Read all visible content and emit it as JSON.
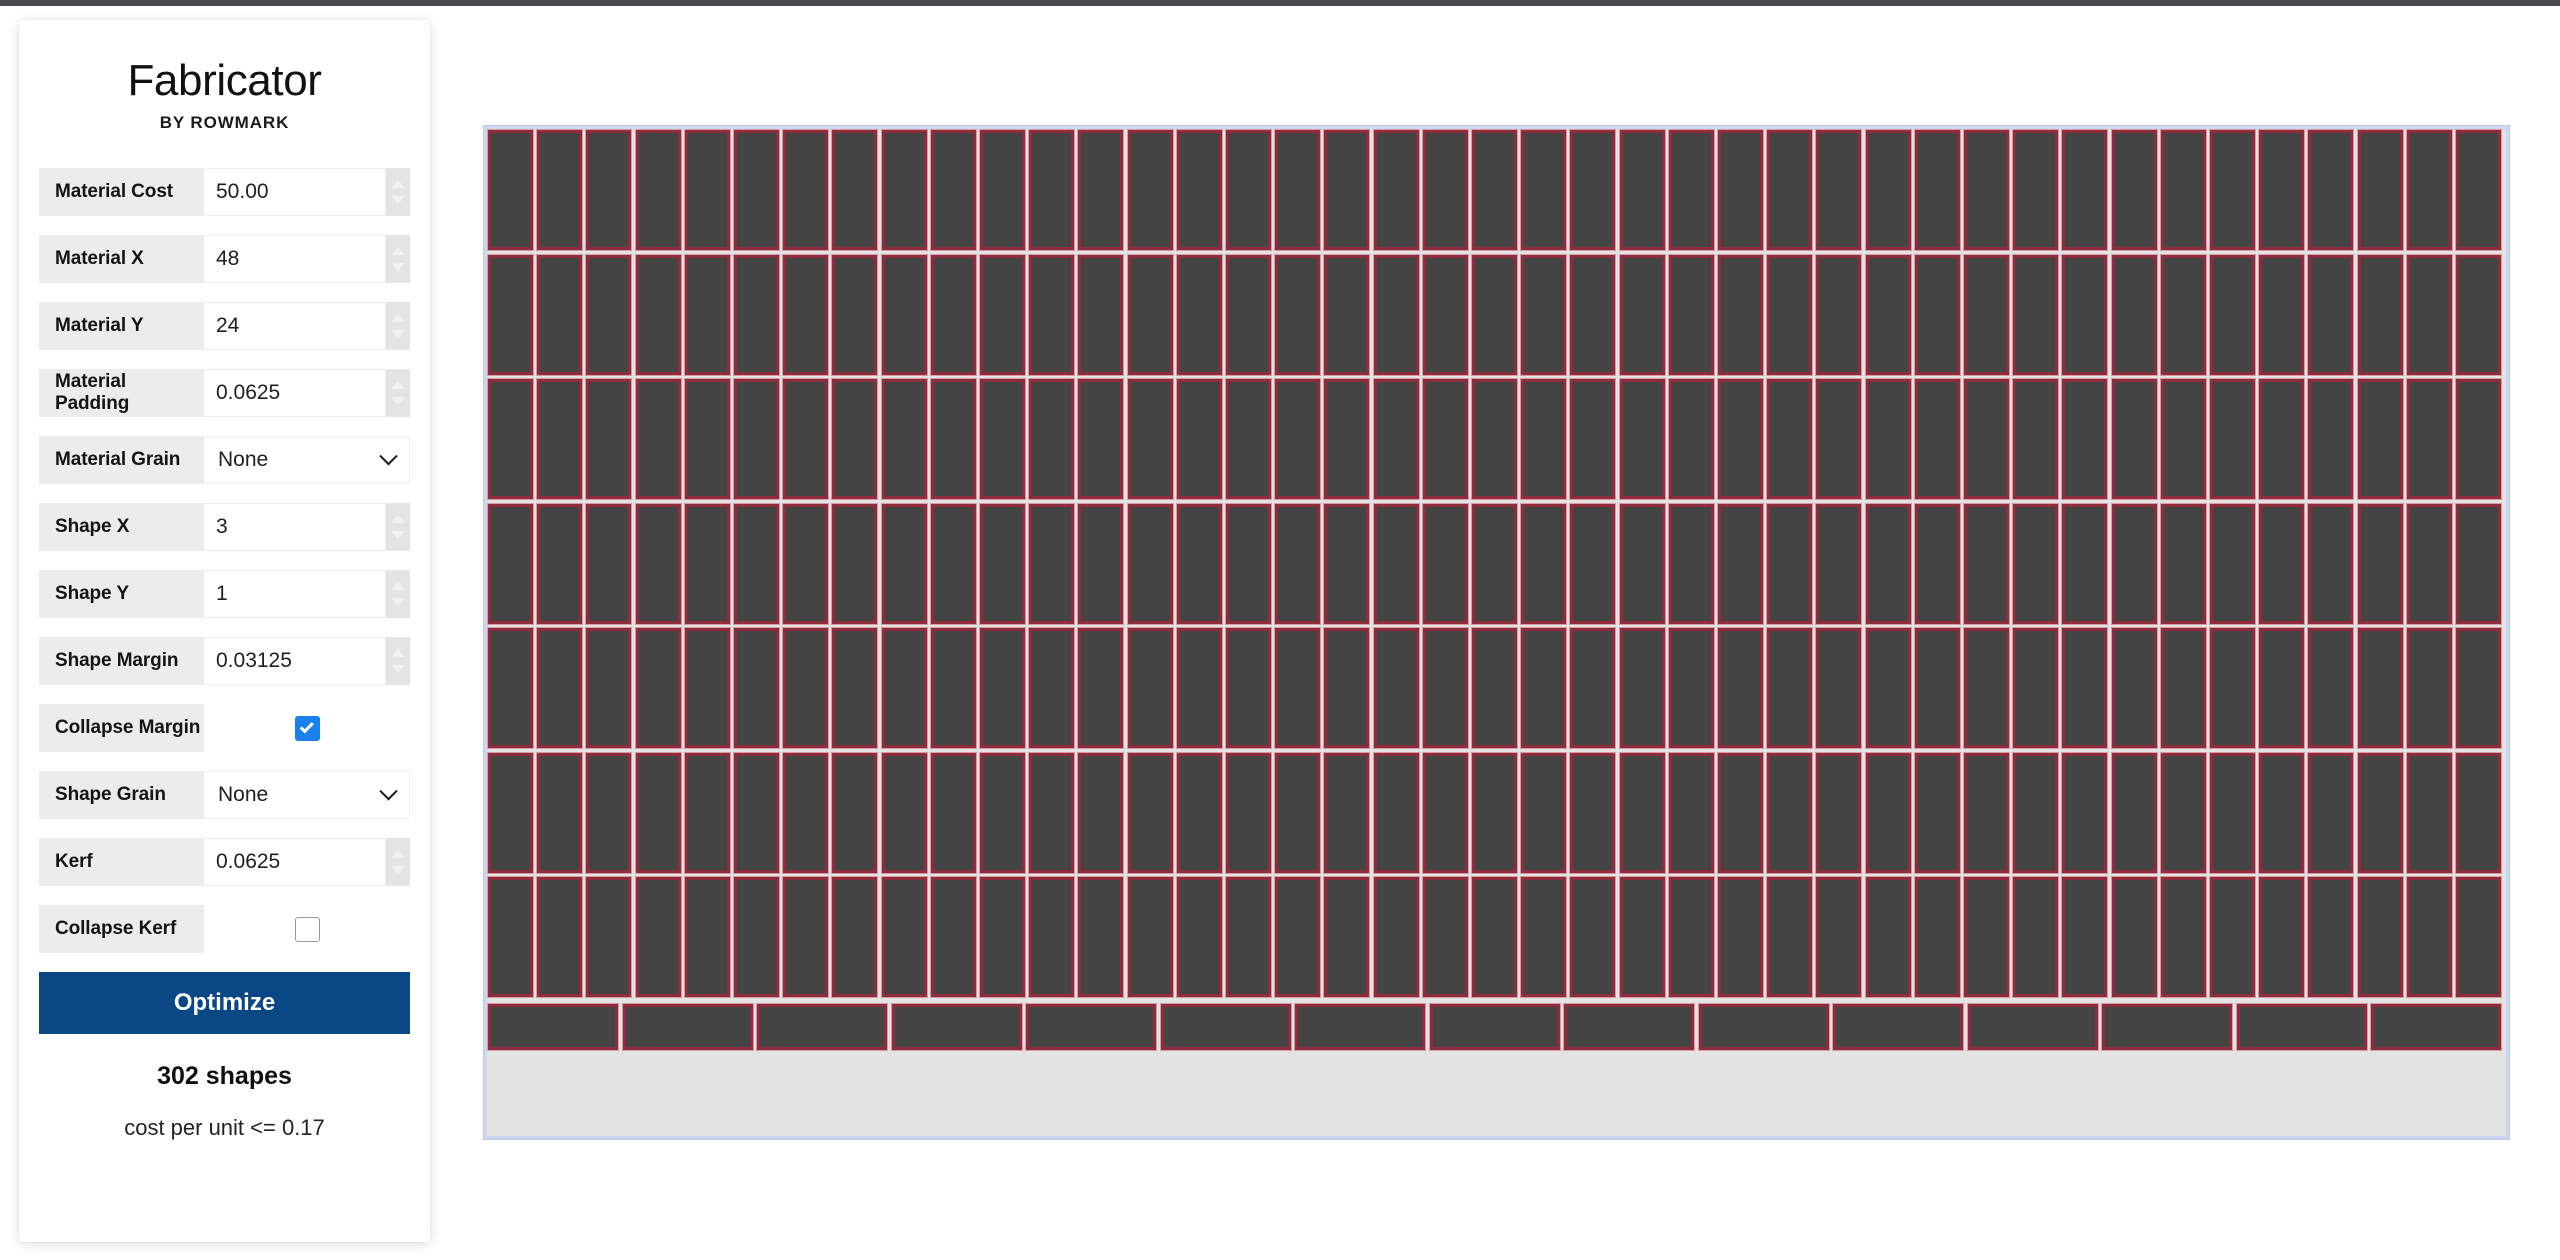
{
  "brand": {
    "title": "Fabricator",
    "subtitle": "BY ROWMARK"
  },
  "form": {
    "fields": [
      {
        "label": "Material Cost",
        "type": "number",
        "value": "50.00"
      },
      {
        "label": "Material X",
        "type": "number",
        "value": "48"
      },
      {
        "label": "Material Y",
        "type": "number",
        "value": "24"
      },
      {
        "label": "Material Padding",
        "type": "number",
        "value": "0.0625"
      },
      {
        "label": "Material Grain",
        "type": "select",
        "value": "None"
      },
      {
        "label": "Shape X",
        "type": "number",
        "value": "3"
      },
      {
        "label": "Shape Y",
        "type": "number",
        "value": "1"
      },
      {
        "label": "Shape Margin",
        "type": "number",
        "value": "0.03125"
      },
      {
        "label": "Collapse Margin",
        "type": "checkbox",
        "value": "checked"
      },
      {
        "label": "Shape Grain",
        "type": "select",
        "value": "None"
      },
      {
        "label": "Kerf",
        "type": "number",
        "value": "0.0625"
      },
      {
        "label": "Collapse Kerf",
        "type": "checkbox",
        "value": "unchecked"
      }
    ]
  },
  "actions": {
    "optimize_label": "Optimize"
  },
  "results": {
    "shape_count": "302 shapes",
    "cost_per_unit": "cost per unit <= 0.17"
  },
  "nesting": {
    "sheet_background": "#e3e3e3",
    "canvas_background": "#ccd7f0",
    "shape_fill": "#444444",
    "shape_border": "#8f2c3c",
    "shape_outline": "#d99aa8",
    "vertical_rows": 7,
    "vertical_columns": 41,
    "horizontal_row_count": 15,
    "total_shapes": 302
  }
}
